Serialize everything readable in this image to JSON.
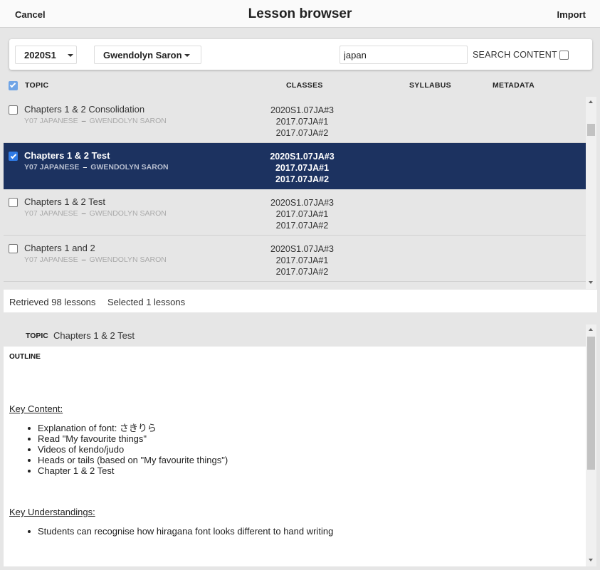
{
  "header": {
    "cancel_label": "Cancel",
    "title": "Lesson browser",
    "import_label": "Import"
  },
  "filters": {
    "semester": "2020S1",
    "teacher": "Gwendolyn Saron",
    "search_value": "japan",
    "search_content_label": "SEARCH CONTENT"
  },
  "table": {
    "columns": [
      "TOPIC",
      "CLASSES",
      "SYLLABUS",
      "METADATA"
    ],
    "rows": [
      {
        "title": "Chapters 1 & 2 Consolidation",
        "subject": "Y07 JAPANESE",
        "teacher": "GWENDOLYN SARON",
        "classes": [
          "2020S1.07JA#3",
          "2017.07JA#1",
          "2017.07JA#2"
        ],
        "selected": false
      },
      {
        "title": "Chapters 1 & 2 Test",
        "subject": "Y07 JAPANESE",
        "teacher": "GWENDOLYN SARON",
        "classes": [
          "2020S1.07JA#3",
          "2017.07JA#1",
          "2017.07JA#2"
        ],
        "selected": true
      },
      {
        "title": "Chapters 1 & 2 Test",
        "subject": "Y07 JAPANESE",
        "teacher": "GWENDOLYN SARON",
        "classes": [
          "2020S1.07JA#3",
          "2017.07JA#1",
          "2017.07JA#2"
        ],
        "selected": false
      },
      {
        "title": "Chapters 1 and 2",
        "subject": "Y07 JAPANESE",
        "teacher": "GWENDOLYN SARON",
        "classes": [
          "2020S1.07JA#3",
          "2017.07JA#1",
          "2017.07JA#2"
        ],
        "selected": false
      }
    ],
    "separator": "–"
  },
  "status": {
    "retrieved": "Retrieved 98 lessons",
    "selected": "Selected 1 lessons"
  },
  "detail": {
    "topic_label": "TOPIC",
    "topic_value": "Chapters 1 & 2 Test",
    "outline_label": "OUTLINE",
    "key_content_heading": "Key Content:",
    "key_content_items": [
      "Explanation of font: さきりら",
      "Read \"My favourite things\"",
      "Videos of kendo/judo",
      "Heads or tails (based on \"My favourite things\")",
      "Chapter 1 & 2 Test"
    ],
    "key_understandings_heading": "Key Understandings:",
    "key_understandings_items": [
      "Students can recognise how hiragana font looks different to hand writing"
    ]
  }
}
